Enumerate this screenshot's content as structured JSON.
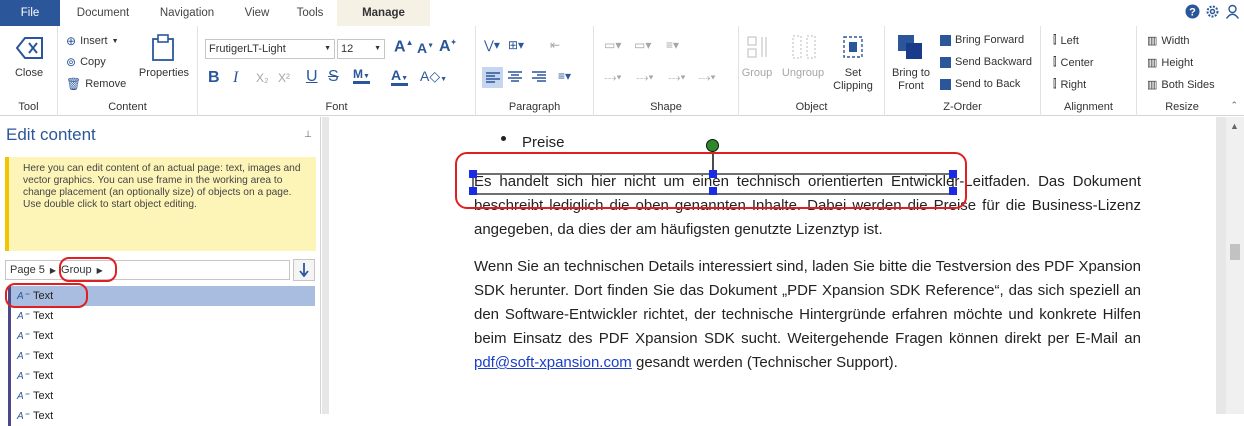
{
  "tabs": {
    "file": "File",
    "document": "Document",
    "navigation": "Navigation",
    "view": "View",
    "tools": "Tools",
    "manage": "Manage"
  },
  "ribbon": {
    "tool": {
      "close": "Close",
      "label": "Tool"
    },
    "content": {
      "insert": "Insert",
      "copy": "Copy",
      "remove": "Remove",
      "properties": "Properties",
      "label": "Content"
    },
    "font": {
      "family": "FrutigerLT-Light",
      "size": "12",
      "label": "Font"
    },
    "paragraph": {
      "label": "Paragraph"
    },
    "shape": {
      "label": "Shape"
    },
    "object": {
      "group": "Group",
      "ungroup": "Ungroup",
      "set_clipping_1": "Set",
      "set_clipping_2": "Clipping",
      "label": "Object"
    },
    "zorder": {
      "bring_to_front_1": "Bring to",
      "bring_to_front_2": "Front",
      "bring_forward": "Bring Forward",
      "send_backward": "Send Backward",
      "send_to_back": "Send to Back",
      "label": "Z-Order"
    },
    "alignment": {
      "left": "Left",
      "center": "Center",
      "right": "Right",
      "label": "Alignment"
    },
    "resize": {
      "width": "Width",
      "height": "Height",
      "both": "Both Sides",
      "label": "Resize"
    }
  },
  "left_panel": {
    "title": "Edit content",
    "info": "Here you can edit content of an actual page: text, images and vector graphics. You can use frame in the working area to change placement (an optionally size) of objects on a page. Use double click to start object editing.",
    "crumb_page": "Page 5",
    "crumb_group": "Group",
    "items": [
      "Text",
      "Text",
      "Text",
      "Text",
      "Text",
      "Text",
      "Text"
    ]
  },
  "document": {
    "bullet": "Preise",
    "p1": "Es handelt sich hier nicht um einen technisch orientierten Entwickler-Leitfaden. Das Dokument beschreibt lediglich die oben genannten Inhalte. Dabei werden die Preise für die Business-Lizenz angegeben, da dies der am häufigsten genutzte Lizenztyp ist.",
    "p2": "Wenn Sie an technischen Details interessiert sind, laden Sie bitte die Testversion des PDF Xpansion SDK herunter. Dort finden Sie das Dokument „PDF Xpansion SDK Reference“, das sich speziell an den Software-Entwickler richtet, der technische Hintergründe erfahren möchte und konkrete Hilfen beim Einsatz des PDF Xpansion SDK sucht. Weitergehende Fragen können direkt per E-Mail an",
    "link": "pdf@soft-xpansion.com",
    "p2_end": "gesandt werden (Technischer Support)."
  },
  "colors": {
    "accent": "#2b579a",
    "highlight": "#e02020",
    "handle": "#1a2be6",
    "selection": "#a9bde0"
  }
}
